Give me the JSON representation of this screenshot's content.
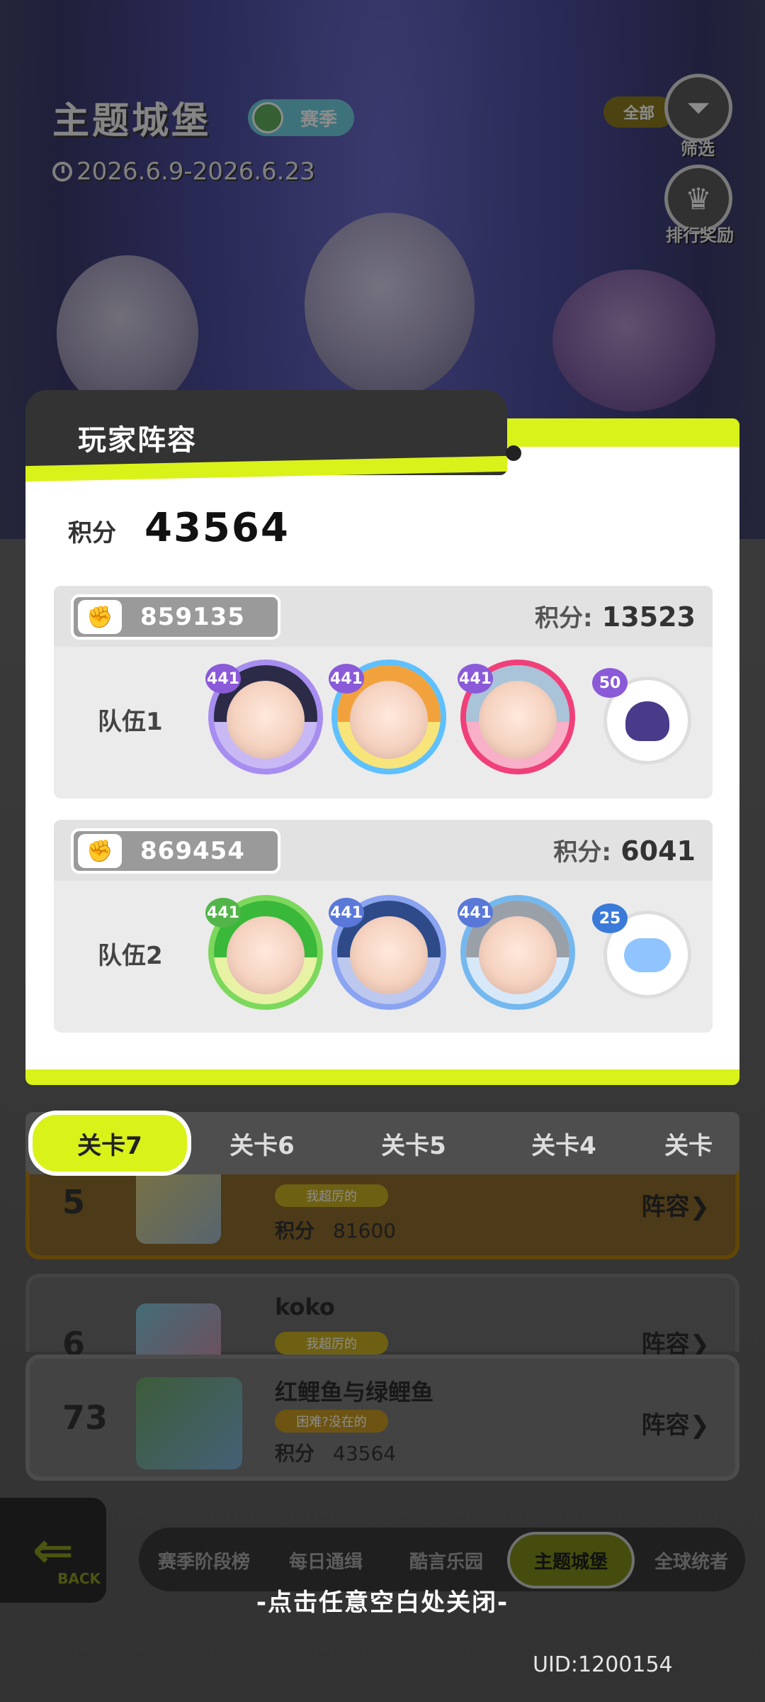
{
  "header": {
    "title": "主题城堡",
    "season_badge": "赛季",
    "date_range": "2026.6.9-2026.6.23",
    "filter_all": "全部",
    "filter_label": "筛选",
    "ranking_reward_label": "排行奖励"
  },
  "modal": {
    "title": "玩家阵容",
    "score_label": "积分",
    "score_value": "43564",
    "teams": [
      {
        "id": "859135",
        "score_label": "积分:",
        "score": "13523",
        "name": "队伍1",
        "hero_levels": [
          "441",
          "441",
          "441"
        ],
        "pet_level": "50"
      },
      {
        "id": "869454",
        "score_label": "积分:",
        "score": "6041",
        "name": "队伍2",
        "hero_levels": [
          "441",
          "441",
          "441"
        ],
        "pet_level": "25"
      }
    ]
  },
  "stage_tabs": [
    "关卡7",
    "关卡6",
    "关卡5",
    "关卡4",
    "关卡"
  ],
  "ranking": [
    {
      "rank": "5",
      "name": "",
      "tag": "我超厉的",
      "score_label": "积分",
      "score": "81600",
      "lineup": "阵容"
    },
    {
      "rank": "6",
      "name": "koko",
      "tag": "我超厉的",
      "lineup": "阵容"
    },
    {
      "rank": "73",
      "name": "红鲤鱼与绿鲤鱼",
      "tag": "困难?没在的",
      "score_label": "积分",
      "score": "43564",
      "lineup": "阵容"
    }
  ],
  "back_label": "BACK",
  "bottom_nav": [
    "赛季阶段榜",
    "每日通缉",
    "酷言乐园",
    "主题城堡",
    "全球统者"
  ],
  "close_hint": "-点击任意空白处关闭-",
  "uid": "UID:1200154",
  "colors": {
    "accent": "#d9f21a",
    "dark": "#333333",
    "modal_bg": "#ffffff"
  }
}
